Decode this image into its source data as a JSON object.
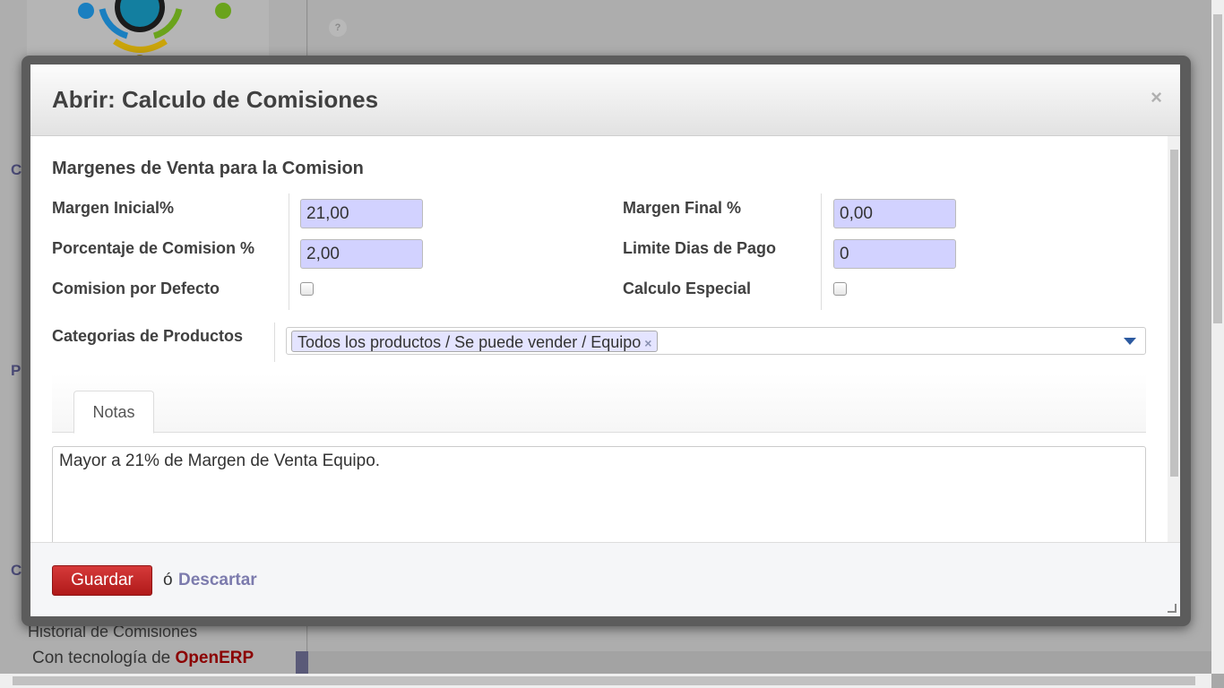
{
  "background": {
    "help_icon": "?",
    "section_fragments": [
      "Cl",
      "Pr",
      "Co"
    ],
    "sidebar_item": "Historial de Comisiones",
    "powered_by_prefix": "Con tecnología de",
    "powered_by_brand": "OpenERP"
  },
  "dialog": {
    "title": "Abrir: Calculo de Comisiones",
    "close_icon": "×",
    "section_title": "Margenes de Venta para la Comision",
    "fields": {
      "margen_inicial": {
        "label": "Margen Inicial%",
        "value": "21,00"
      },
      "margen_final": {
        "label": "Margen Final %",
        "value": "0,00"
      },
      "porcentaje_comision": {
        "label": "Porcentaje de Comision %",
        "value": "2,00"
      },
      "limite_dias": {
        "label": "Limite Dias de Pago",
        "value": "0"
      },
      "comision_defecto": {
        "label": "Comision por Defecto",
        "checked": false
      },
      "calculo_especial": {
        "label": "Calculo Especial",
        "checked": false
      },
      "categorias": {
        "label": "Categorias de Productos",
        "tags": [
          "Todos los productos / Se puede vender / Equipo"
        ],
        "remove_icon": "×"
      }
    },
    "tabs": [
      {
        "label": "Notas",
        "active": true
      }
    ],
    "notes": "Mayor a 21% de Margen de Venta Equipo.",
    "footer": {
      "save_label": "Guardar",
      "or_label": "ó",
      "discard_label": "Descartar"
    }
  },
  "colors": {
    "accent_red": "#c0282d",
    "input_required": "#d2d2ff",
    "link": "#7c7bad"
  }
}
